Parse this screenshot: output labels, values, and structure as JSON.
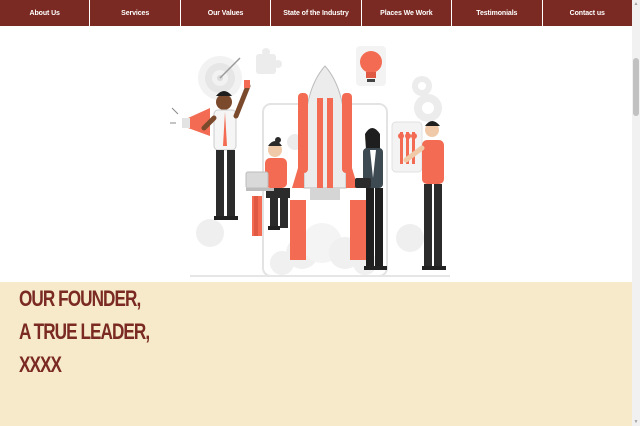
{
  "nav": {
    "items": [
      {
        "label": "About Us"
      },
      {
        "label": "Services"
      },
      {
        "label": "Our Values"
      },
      {
        "label": "State of the Industry"
      },
      {
        "label": "Places We Work"
      },
      {
        "label": "Testimonials"
      },
      {
        "label": "Contact us"
      }
    ]
  },
  "founder": {
    "lines": [
      "OUR FOUNDER,",
      "A TRUE LEADER,",
      "XXXX"
    ]
  },
  "colors": {
    "nav_bg": "#7a2a22",
    "accent": "#f26b52",
    "founder_bg": "#f7eacb",
    "founder_text": "#7a2a22"
  },
  "icons": [
    "target-icon",
    "megaphone-icon",
    "lightbulb-icon",
    "rocket-icon",
    "gear-icon",
    "puzzle-icon",
    "laptop-icon",
    "tablet-icon"
  ]
}
